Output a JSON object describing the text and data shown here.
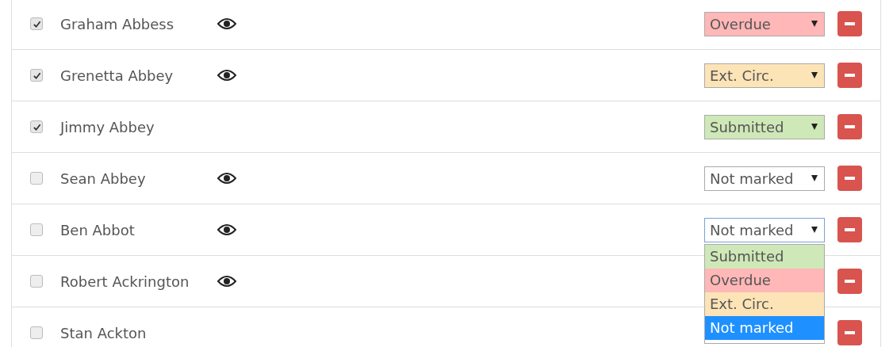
{
  "rows": [
    {
      "name": "Graham Abbess",
      "checked": true,
      "preview": true,
      "status": {
        "value": "Overdue",
        "kind": "overdue",
        "open": false
      }
    },
    {
      "name": "Grenetta Abbey",
      "checked": true,
      "preview": true,
      "status": {
        "value": "Ext. Circ.",
        "kind": "ext_circ",
        "open": false
      }
    },
    {
      "name": "Jimmy Abbey",
      "checked": true,
      "preview": false,
      "status": {
        "value": "Submitted",
        "kind": "submitted",
        "open": false
      }
    },
    {
      "name": "Sean Abbey",
      "checked": false,
      "preview": true,
      "status": {
        "value": "Not marked",
        "kind": "not_marked",
        "open": false
      }
    },
    {
      "name": "Ben Abbot",
      "checked": false,
      "preview": true,
      "status": {
        "value": "Not marked",
        "kind": "not_marked",
        "open": true,
        "options": [
          {
            "label": "Submitted",
            "kind": "submitted",
            "selected": false
          },
          {
            "label": "Overdue",
            "kind": "overdue",
            "selected": false
          },
          {
            "label": "Ext. Circ.",
            "kind": "ext_circ",
            "selected": false
          },
          {
            "label": "Not marked",
            "selected": true
          }
        ]
      }
    },
    {
      "name": "Robert Ackrington",
      "checked": false,
      "preview": true
    },
    {
      "name": "Stan Ackton",
      "checked": false,
      "preview": false
    }
  ]
}
